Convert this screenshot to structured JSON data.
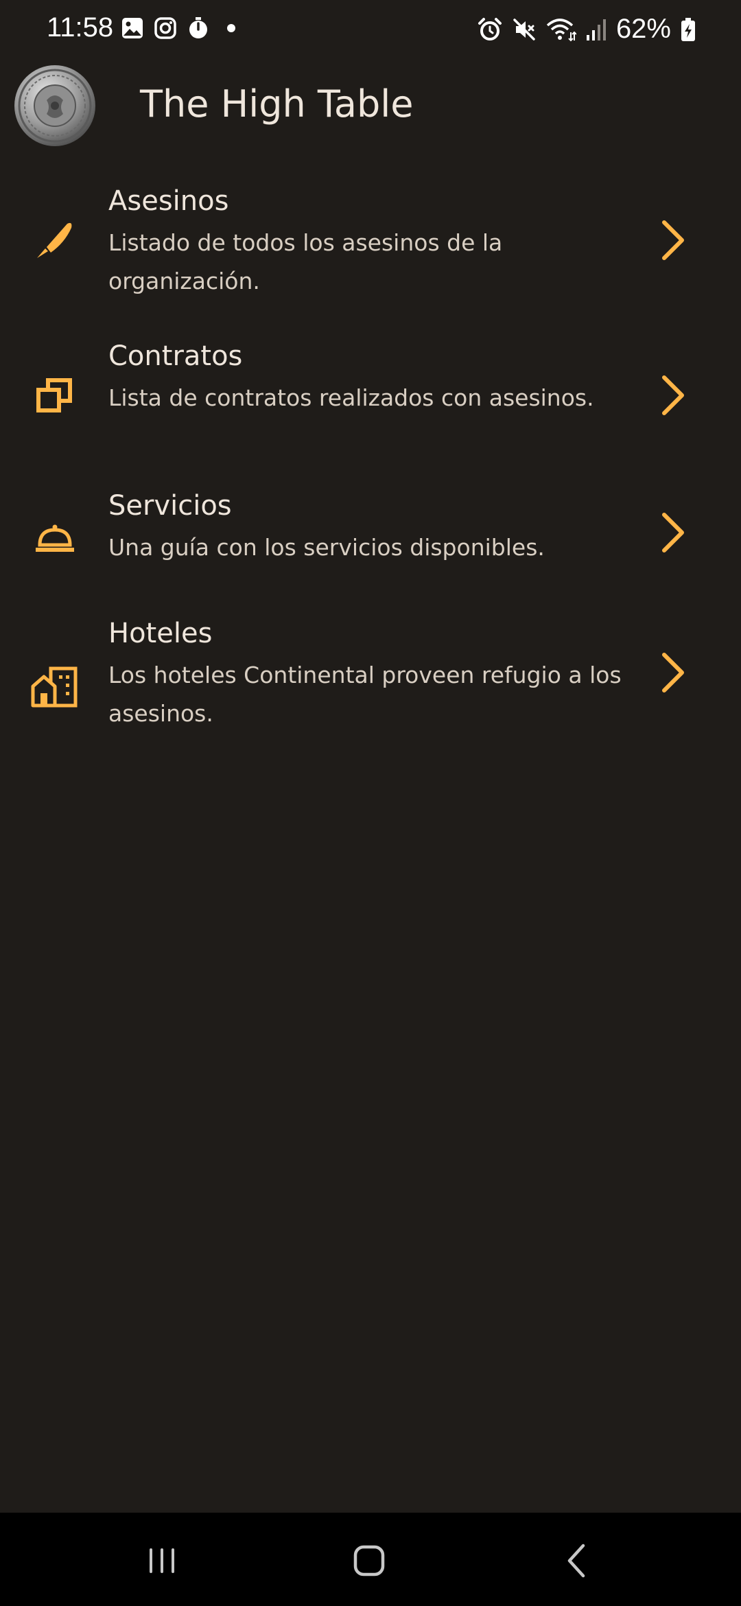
{
  "status_bar": {
    "time": "11:58",
    "battery": "62%",
    "left_icons": [
      "gallery-icon",
      "instagram-icon",
      "timer-icon",
      "dot-icon"
    ],
    "right_icons": [
      "alarm-icon",
      "mute-icon",
      "wifi-icon",
      "signal-icon",
      "battery-charging-icon"
    ]
  },
  "app_bar": {
    "title": "The High Table",
    "avatar_icon": "coin-avatar"
  },
  "accent_color": "#ffb547",
  "menu": [
    {
      "title": "Asesinos",
      "description": "Listado de todos los asesinos de la organización.",
      "icon": "knife-icon"
    },
    {
      "title": "Contratos",
      "description": "Lista de contratos realizados con asesinos.",
      "icon": "documents-icon"
    },
    {
      "title": "Servicios",
      "description": "Una guía con los servicios disponibles.",
      "icon": "service-bell-icon"
    },
    {
      "title": "Hoteles",
      "description": "Los hoteles Continental proveen refugio a los asesinos.",
      "icon": "hotel-icon"
    }
  ],
  "nav_bar": {
    "buttons": [
      "recent-apps-icon",
      "home-icon",
      "back-icon"
    ]
  }
}
